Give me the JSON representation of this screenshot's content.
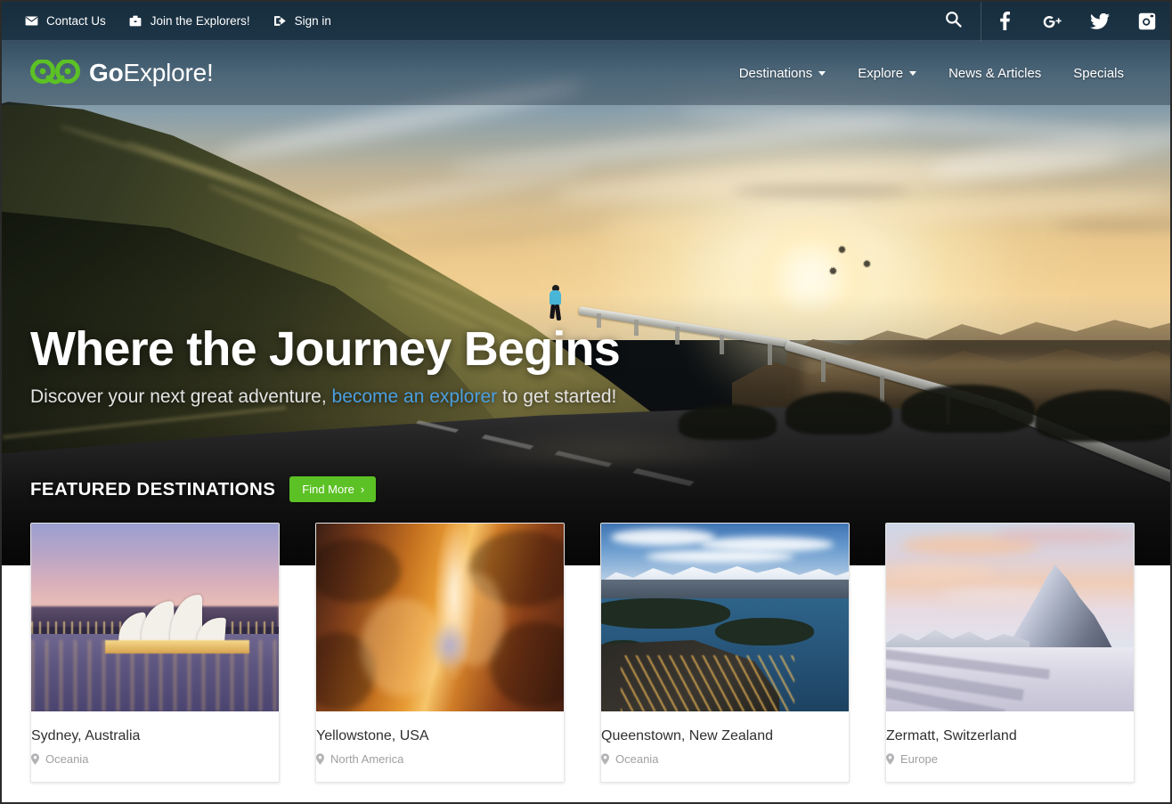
{
  "topbar": {
    "links": [
      {
        "label": "Contact Us",
        "icon": "envelope-icon"
      },
      {
        "label": "Join the Explorers!",
        "icon": "briefcase-icon"
      },
      {
        "label": "Sign in",
        "icon": "sign-in-icon"
      }
    ],
    "search_icon": "search-icon",
    "socials": [
      {
        "name": "facebook-icon",
        "label": "f"
      },
      {
        "name": "google-plus-icon",
        "label": "g+"
      },
      {
        "name": "twitter-icon",
        "label": "twitter"
      },
      {
        "name": "instagram-icon",
        "label": "instagram"
      }
    ]
  },
  "brand": {
    "name_strong": "Go",
    "name_rest": "Explore!",
    "logo_icon": "owl-binoculars-logo",
    "logo_color": "#5cc124"
  },
  "nav": {
    "items": [
      {
        "label": "Destinations",
        "has_dropdown": true
      },
      {
        "label": "Explore",
        "has_dropdown": true
      },
      {
        "label": "News & Articles",
        "has_dropdown": false
      },
      {
        "label": "Specials",
        "has_dropdown": false
      }
    ]
  },
  "hero": {
    "title": "Where the Journey Begins",
    "sub_before": "Discover your next great adventure, ",
    "sub_link": "become an explorer",
    "sub_after": " to get started!",
    "link_color": "#4b9fe0"
  },
  "featured": {
    "title": "FEATURED DESTINATIONS",
    "button_label": "Find More",
    "button_chevron": "›",
    "button_color": "#5cc124"
  },
  "cards": [
    {
      "title": "Sydney, Australia",
      "region": "Oceania",
      "pin_icon": "map-pin-icon",
      "thumb": "sydney-opera-house-at-dusk"
    },
    {
      "title": "Yellowstone, USA",
      "region": "North America",
      "pin_icon": "map-pin-icon",
      "thumb": "slot-canyon-light-beam"
    },
    {
      "title": "Queenstown, New Zealand",
      "region": "Oceania",
      "pin_icon": "map-pin-icon",
      "thumb": "queenstown-lake-and-snowy-mountains"
    },
    {
      "title": "Zermatt, Switzerland",
      "region": "Europe",
      "pin_icon": "map-pin-icon",
      "thumb": "matterhorn-at-sunset"
    }
  ]
}
